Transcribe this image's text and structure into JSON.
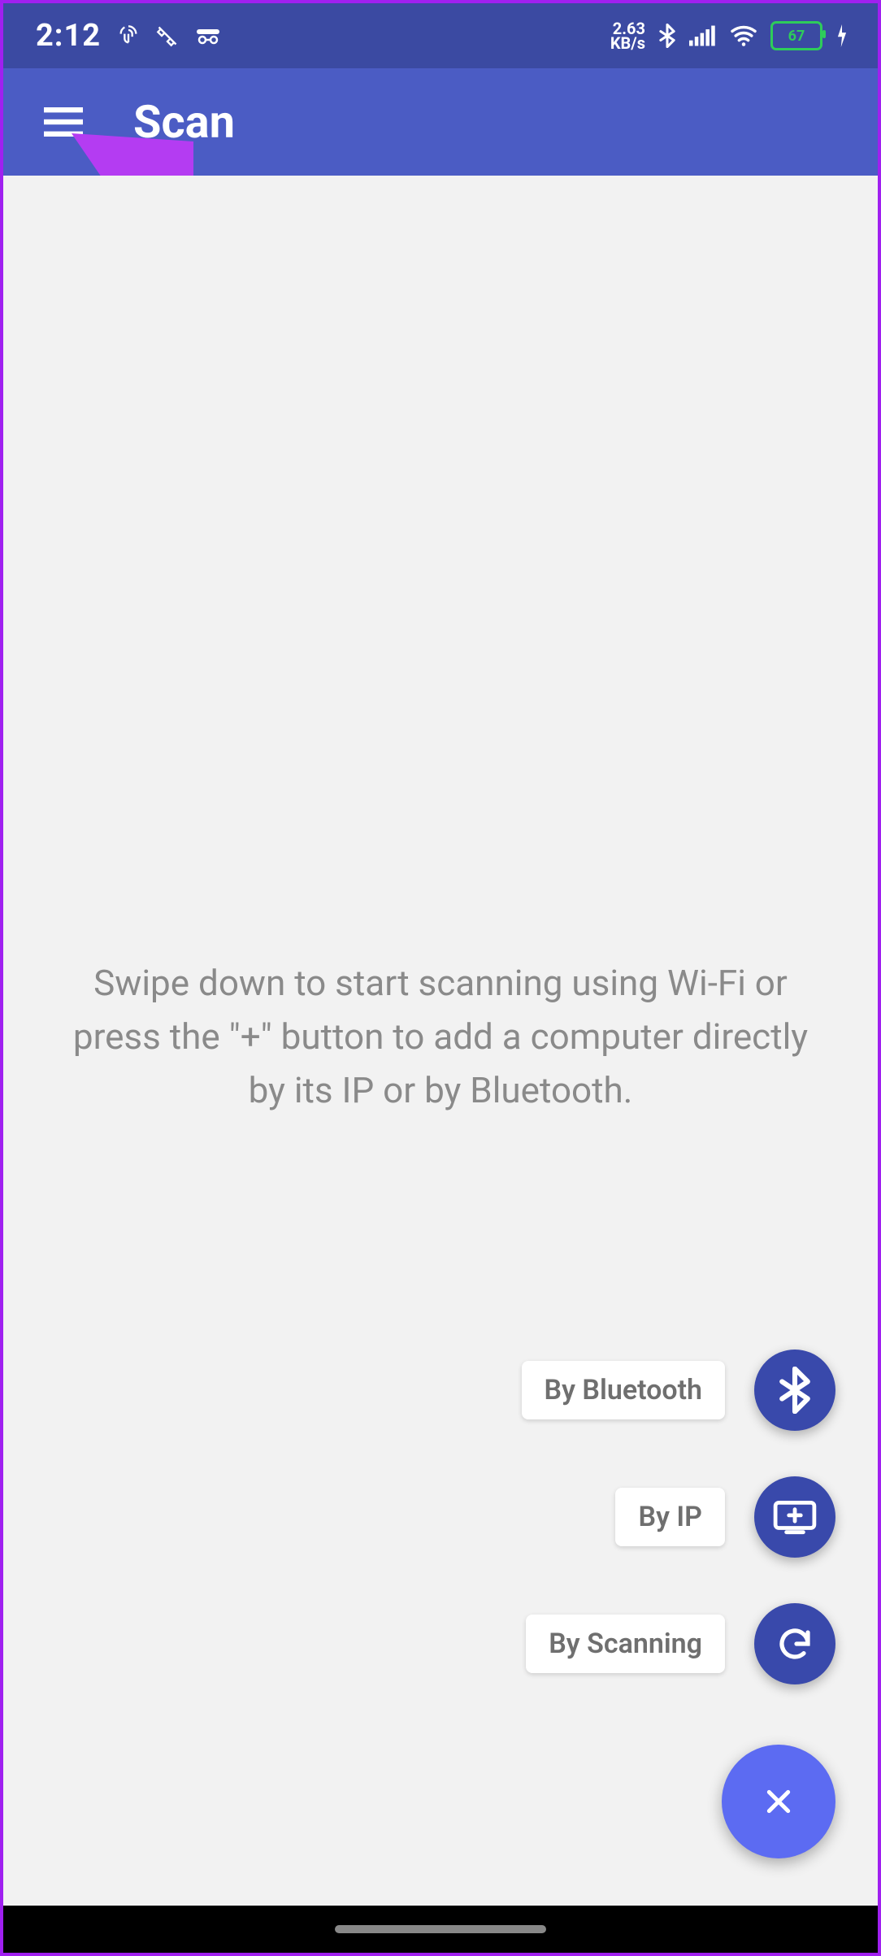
{
  "status_bar": {
    "clock": "2:12",
    "data_speed_top": "2.63",
    "data_speed_bottom": "KB/s",
    "battery_pct": "67"
  },
  "app_bar": {
    "title": "Scan"
  },
  "content": {
    "empty_message": "Swipe down to start scanning using Wi-Fi or press the \"+\" button to add a computer directly by its IP or by Bluetooth."
  },
  "speed_dial": {
    "item_bluetooth": "By Bluetooth",
    "item_ip": "By IP",
    "item_scan": "By Scanning"
  },
  "colors": {
    "status_bar_bg": "#3b4aa2",
    "app_bar_bg": "#4b5cc4",
    "fab_bg": "#5c6bf2",
    "mini_fab_bg": "#3949ab",
    "annotation_arrow": "#b43cf2",
    "battery_green": "#2ecc5a"
  }
}
